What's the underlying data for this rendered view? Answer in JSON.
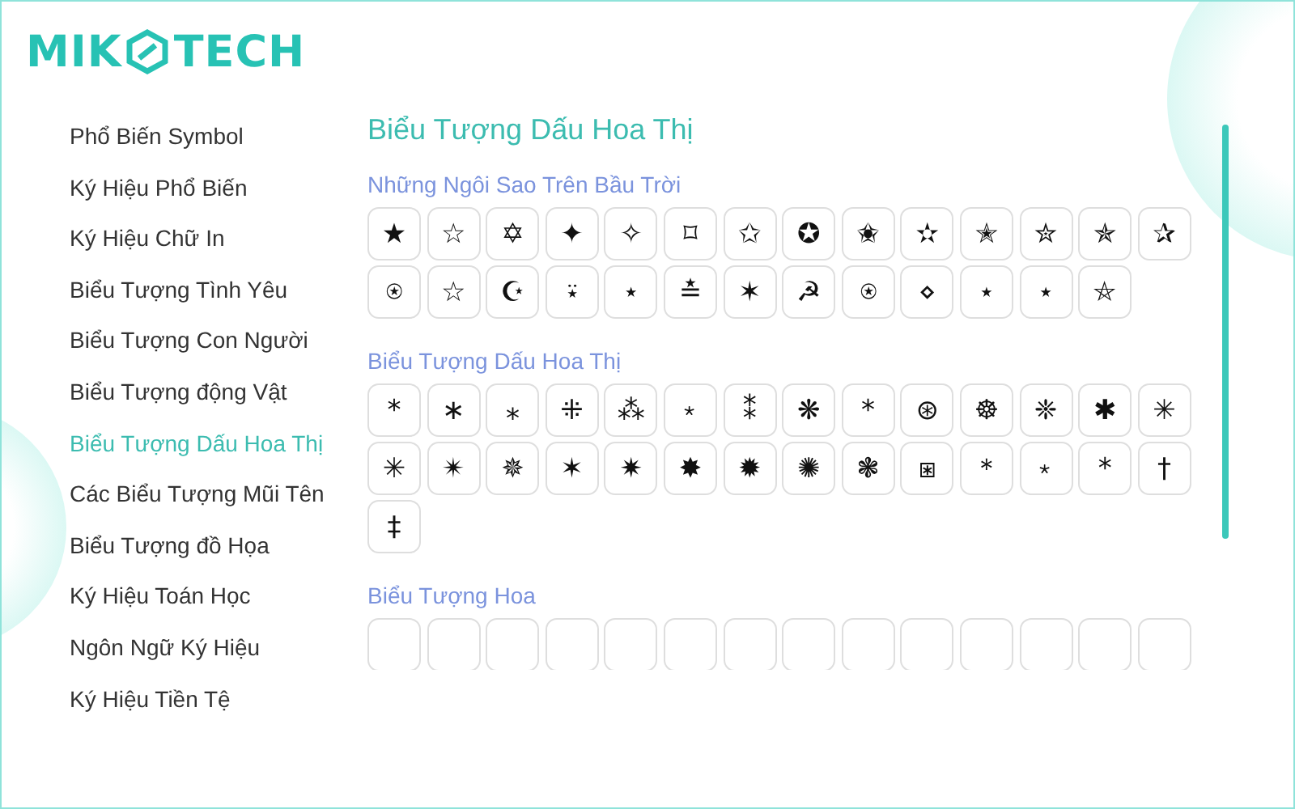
{
  "logo": {
    "left": "MIK",
    "right": "TECH"
  },
  "sidebar": {
    "items": [
      {
        "label": "Phổ Biến Symbol",
        "selected": false
      },
      {
        "label": "Ký Hiệu Phổ Biến",
        "selected": false
      },
      {
        "label": "Ký Hiệu Chữ In",
        "selected": false
      },
      {
        "label": "Biểu Tượng Tình Yêu",
        "selected": false
      },
      {
        "label": "Biểu Tượng Con Người",
        "selected": false
      },
      {
        "label": "Biểu Tượng động Vật",
        "selected": false
      },
      {
        "label": "Biểu Tượng Dấu Hoa Thị",
        "selected": true
      },
      {
        "label": "Các Biểu Tượng Mũi Tên",
        "selected": false
      },
      {
        "label": "Biểu Tượng đồ Họa",
        "selected": false
      },
      {
        "label": "Ký Hiệu Toán Học",
        "selected": false
      },
      {
        "label": "Ngôn Ngữ Ký Hiệu",
        "selected": false
      },
      {
        "label": "Ký Hiệu Tiền Tệ",
        "selected": false
      }
    ]
  },
  "content": {
    "title": "Biểu Tượng Dấu Hoa Thị",
    "sections": [
      {
        "heading": "Những Ngôi Sao Trên Bầu Trời",
        "symbols": [
          "★",
          "☆",
          "✡",
          "✦",
          "✧",
          "⌑",
          "✩",
          "✪",
          "✬",
          "✫",
          "✭",
          "✮",
          "✯",
          "✰",
          "⍟",
          "☆",
          "☪",
          "⍣",
          "⋆",
          "≛",
          "✶",
          "☭",
          "⍟",
          "⋄",
          "⋆",
          "⋆",
          "⛤"
        ]
      },
      {
        "heading": "Biểu Tượng Dấu Hoa Thị",
        "symbols": [
          "*",
          "∗",
          "⁎",
          "⁜",
          "⁂",
          "﹡",
          "⁑",
          "❋",
          "*",
          "⊛",
          "☸",
          "❈",
          "✱",
          "✳",
          "✳",
          "✴",
          "✵",
          "✶",
          "✷",
          "✸",
          "✹",
          "✺",
          "❃",
          "⧆",
          "＊",
          "﹡",
          "*",
          "†",
          "‡"
        ]
      },
      {
        "heading": "Biểu Tượng Hoa"
      }
    ]
  }
}
